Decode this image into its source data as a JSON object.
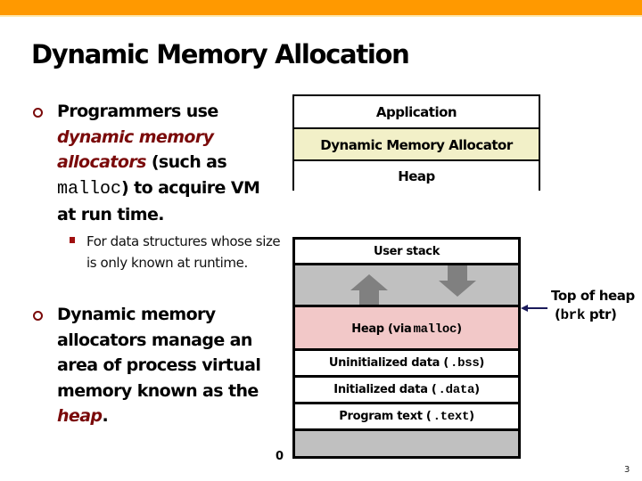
{
  "slide": {
    "title": "Dynamic Memory Allocation",
    "page_number": "3",
    "accent_color": "#FF9900",
    "emphasis_color": "#7A0A0A"
  },
  "bullets": [
    {
      "icon": "hollow-circle-bullet",
      "parts": {
        "p1": "Programmers use",
        "em1": "dynamic memory allocators",
        "p2": " (such as",
        "code": "malloc",
        "p3": ") to acquire VM at run time."
      },
      "sub_bullets": [
        {
          "icon": "square-bullet",
          "text": "For data structures whose size is only known at runtime."
        }
      ]
    },
    {
      "icon": "hollow-circle-bullet",
      "parts": {
        "p1": "Dynamic memory allocators manage an area of process virtual memory known as the",
        "em1": "heap",
        "p2": "."
      }
    }
  ],
  "layers_diagram": {
    "rows": [
      {
        "label": "Application",
        "fill": "#FFFFFF"
      },
      {
        "label": "Dynamic Memory Allocator",
        "fill": "#F2F0C8"
      },
      {
        "label": "Heap",
        "fill": "#FFFFFF"
      }
    ]
  },
  "memory_layout": {
    "rows": [
      {
        "label": "User stack",
        "fill": "#FFFFFF"
      },
      {
        "label": "",
        "fill": "#C0C0C0",
        "note": "free area with growth arrows"
      },
      {
        "label": "Heap (via ",
        "code": "malloc",
        "suffix": ")",
        "fill": "#F2C8C8"
      },
      {
        "label": "Uninitialized data (",
        "code": ".bss",
        "suffix": ")",
        "fill": "#FFFFFF"
      },
      {
        "label": "Initialized data (",
        "code": ".data",
        "suffix": ")",
        "fill": "#FFFFFF"
      },
      {
        "label": "Program text (",
        "code": ".text",
        "suffix": ")",
        "fill": "#FFFFFF"
      },
      {
        "label": "",
        "fill": "#C0C0C0"
      }
    ],
    "address_zero_label": "0",
    "pointer": {
      "line1": "Top of heap",
      "line2_open": "(",
      "line2_code": "brk",
      "line2_rest": " ptr)",
      "arrow_color": "#1A1A5A"
    },
    "arrows": [
      {
        "name": "heap-grows-up-arrow",
        "direction": "up",
        "color": "#808080"
      },
      {
        "name": "stack-grows-down-arrow",
        "direction": "down",
        "color": "#808080"
      }
    ]
  }
}
